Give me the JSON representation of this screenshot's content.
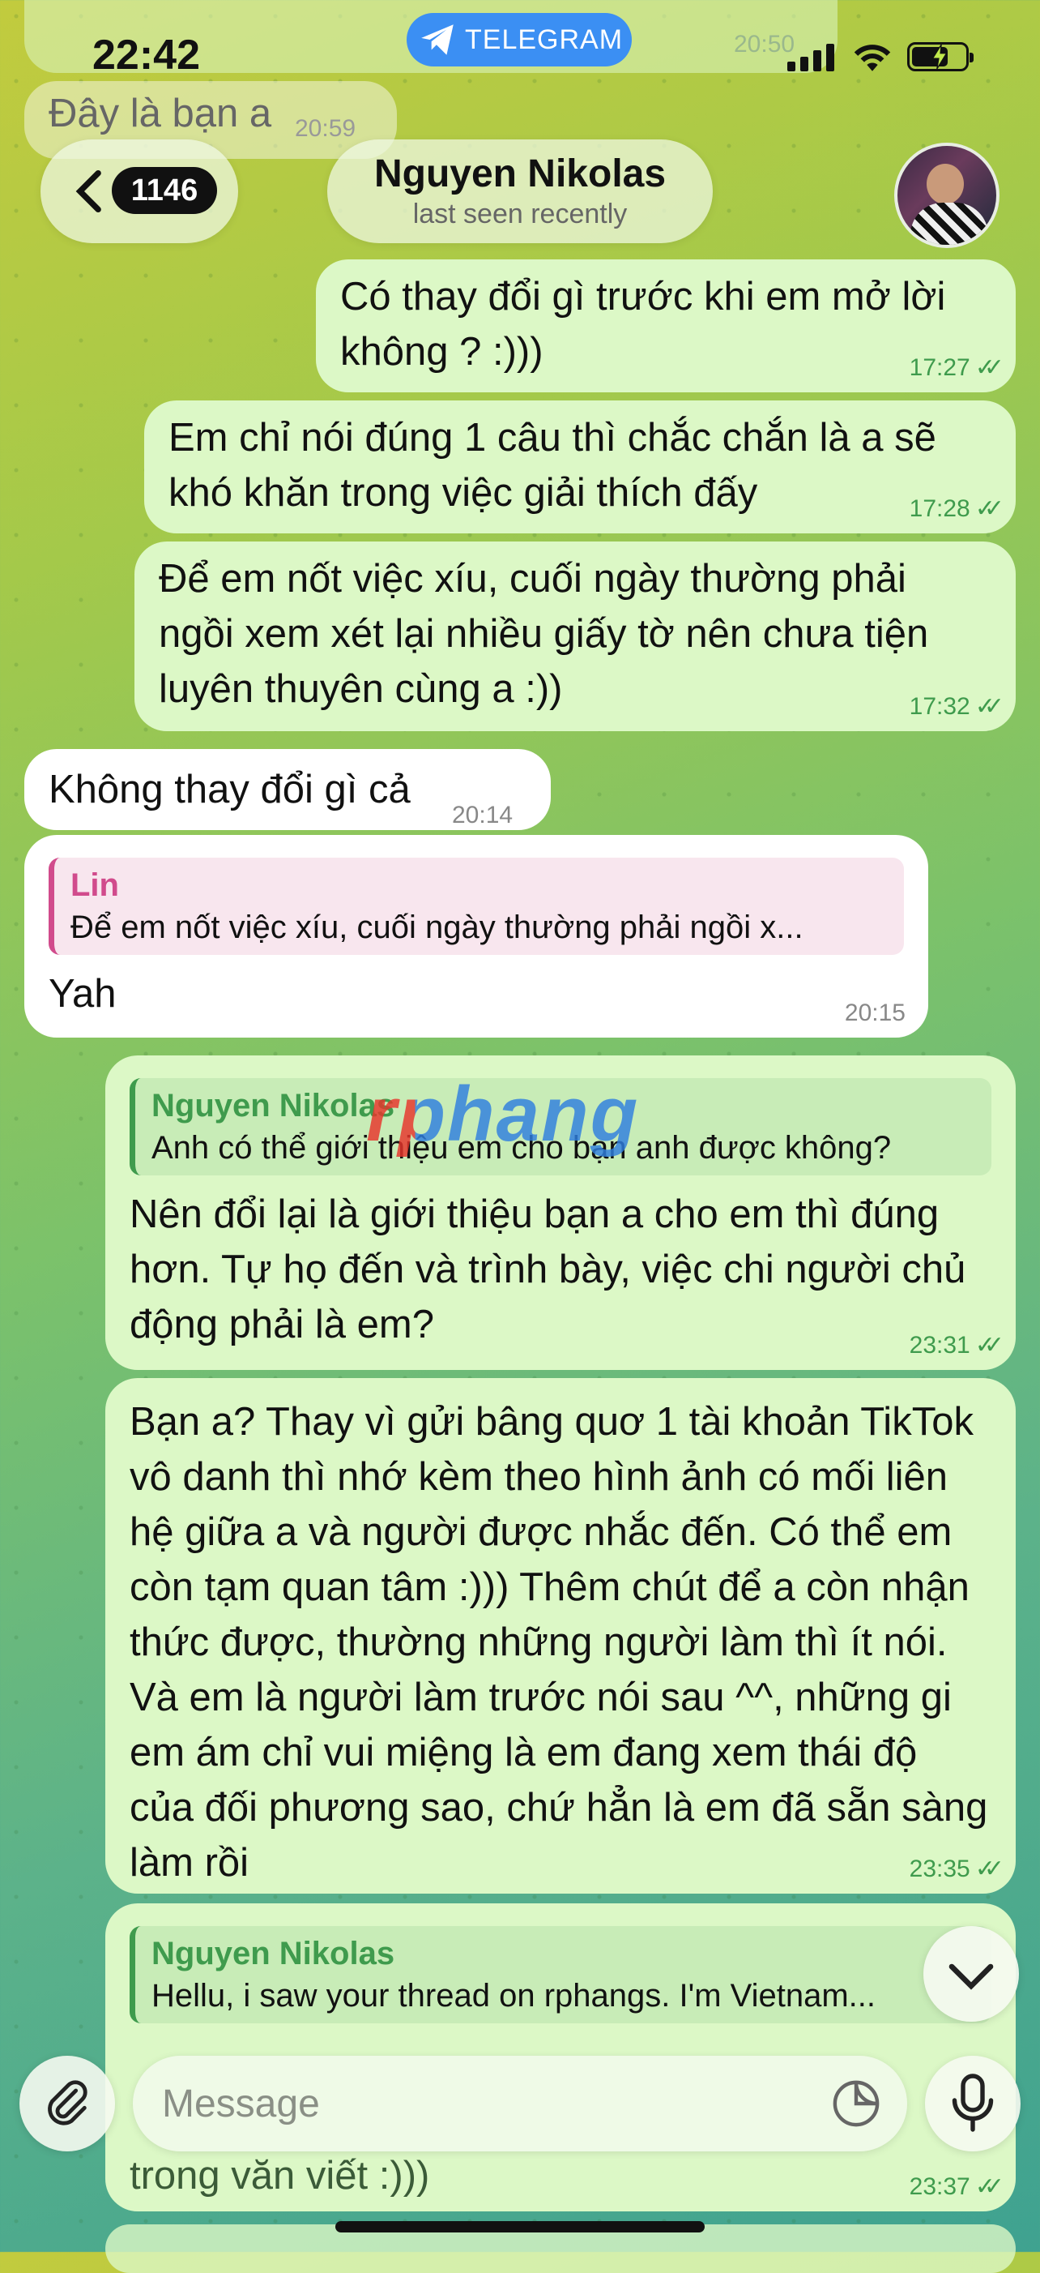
{
  "status_bar": {
    "time": "22:42",
    "app_pill": "TELEGRAM",
    "battery": "charging"
  },
  "partial_top": {
    "text": "Đây là bạn a",
    "time": "20:59",
    "faded_time": "20:50"
  },
  "header": {
    "back_count": "1146",
    "name": "Nguyen Nikolas",
    "status": "last seen recently"
  },
  "messages": [
    {
      "dir": "out",
      "text": "Có thay đổi gì trước khi em mở lời không ? :)))",
      "time": "17:27"
    },
    {
      "dir": "out",
      "text": "Em chỉ nói đúng 1 câu thì chắc chắn là a sẽ khó khăn trong việc giải thích đấy",
      "time": "17:28"
    },
    {
      "dir": "out",
      "text": "Để em nốt việc xíu, cuối ngày thường phải ngồi xem xét lại nhiều giấy tờ nên chưa tiện luyên thuyên cùng a :))",
      "time": "17:32"
    },
    {
      "dir": "in",
      "text": "Không thay đổi gì cả",
      "time": "20:14"
    },
    {
      "dir": "in",
      "reply_name": "Lin",
      "reply_text": "Để em nốt việc xíu, cuối ngày thường phải ngồi x...",
      "text": "Yah",
      "time": "20:15"
    },
    {
      "dir": "out",
      "reply_name": "Nguyen Nikolas",
      "reply_text": "Anh có thể giới thiệu em cho bạn anh được không?",
      "text": "Nên đổi lại là giới thiệu bạn a cho em thì đúng hơn. Tự họ đến và trình bày, việc chi người chủ động phải là em?",
      "time": "23:31"
    },
    {
      "dir": "out",
      "text": "Bạn a? Thay vì gửi bâng quơ 1 tài khoản TikTok vô danh thì nhớ kèm theo hình ảnh có mối liên hệ giữa a và người được nhắc đến. Có thể em còn tạm quan tâm :))) Thêm chút để a còn nhận thức được, thường những người làm thì ít nói. Và em là người làm trước nói sau ^^, những gi em ám chỉ vui miệng là em đang xem thái độ của đối phương sao, chứ hẳn là em đã sẵn sàng làm rồi",
      "time": "23:35"
    },
    {
      "dir": "out",
      "reply_name": "Nguyen Nikolas",
      "reply_text": "Hellu, i saw your thread on rphangs. I'm Vietnam...",
      "text": "trong văn viết :)))",
      "time": "23:37"
    }
  ],
  "watermark": "rphang",
  "composer": {
    "placeholder": "Message"
  }
}
